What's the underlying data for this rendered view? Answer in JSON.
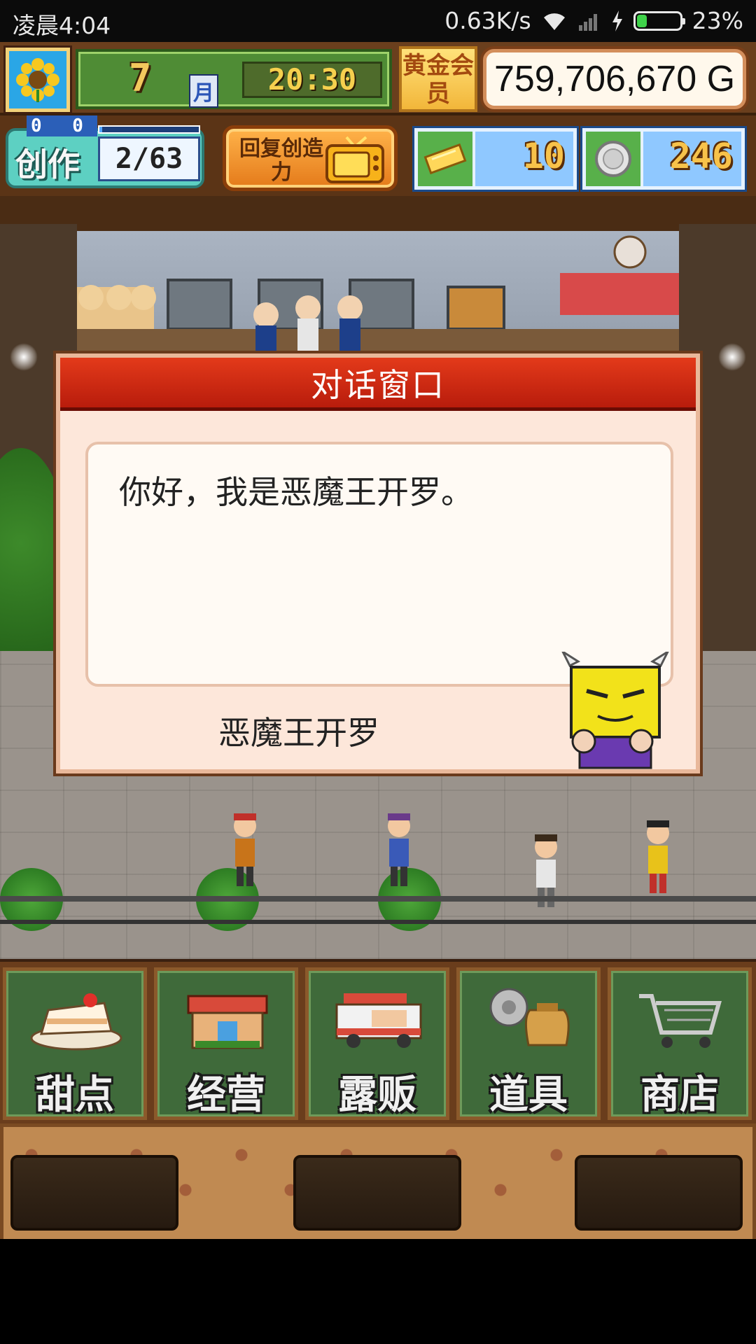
{
  "status_bar": {
    "time": "凌晨4:04",
    "network_speed": "0.63K/s",
    "battery_percent": "23%",
    "battery_level": 0.23,
    "icons": [
      "wifi-icon",
      "signal-icon",
      "charging-bolt-icon",
      "battery-icon"
    ]
  },
  "hud": {
    "month_number": "7",
    "month_label": "月",
    "clock": "20:30",
    "member_badge": "黄金会员",
    "money": "759,706,670 G",
    "create_label": "创作",
    "create_top_digits": "0 0",
    "create_progress": "2/63",
    "create_fill": 0.03,
    "recover_label": "回复创造力",
    "tickets": "10",
    "coins": "246",
    "colors": {
      "gold": "#f7c24a",
      "teal": "#5dd0c2",
      "orange": "#e47a1a"
    }
  },
  "dialog": {
    "title": "对话窗口",
    "text": "你好，我是恶魔王开罗。",
    "speaker": "恶魔王开罗",
    "title_color": "#c8220f"
  },
  "menu": {
    "items": [
      {
        "label": "甜点",
        "icon": "cake-icon"
      },
      {
        "label": "经营",
        "icon": "shop-icon"
      },
      {
        "label": "露贩",
        "icon": "food-truck-icon"
      },
      {
        "label": "道具",
        "icon": "items-bag-icon"
      },
      {
        "label": "商店",
        "icon": "cart-icon"
      }
    ]
  }
}
